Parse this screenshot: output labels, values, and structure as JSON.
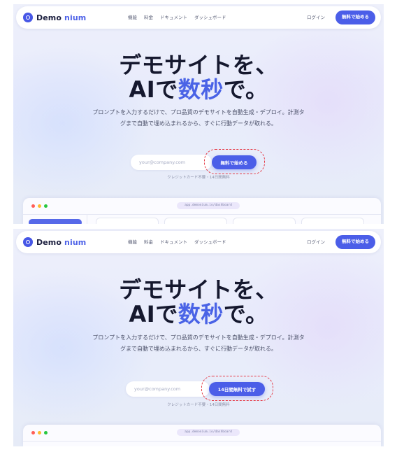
{
  "frames": [
    {
      "nav": {
        "brand_left": "Demo",
        "brand_right": "nium",
        "menu": [
          "機能",
          "料金",
          "ドキュメント",
          "ダッシュボード"
        ],
        "login": "ログイン",
        "cta": "無料で始める"
      },
      "hero": {
        "title_line1": "デモサイトを、",
        "title_ai": "AIで",
        "title_accent": "数秒",
        "title_end": "で。",
        "subtitle": "プロンプトを入力するだけで、プロ品質のデモサイトを自動生成・デプロイ。計測タグまで自動で埋め込まれるから、すぐに行動データが取れる。"
      },
      "form": {
        "email_placeholder": "your@company.com",
        "cta": "無料で始める",
        "note": "クレジットカード不要・14日間無料"
      },
      "browser": {
        "url": "app.demonium.io/dashboard"
      }
    },
    {
      "nav": {
        "brand_left": "Demo",
        "brand_right": "nium",
        "menu": [
          "機能",
          "料金",
          "ドキュメント",
          "ダッシュボード"
        ],
        "login": "ログイン",
        "cta": "無料で始める"
      },
      "hero": {
        "title_line1": "デモサイトを、",
        "title_ai": "AIで",
        "title_accent": "数秒",
        "title_end": "で。",
        "subtitle": "プロンプトを入力するだけで、プロ品質のデモサイトを自動生成・デプロイ。計測タグまで自動で埋め込まれるから、すぐに行動データが取れる。"
      },
      "form": {
        "email_placeholder": "your@company.com",
        "cta": "14日間無料で試す",
        "note": "クレジットカード不要・14日間無料"
      },
      "browser": {
        "url": "app.demonium.io/dashboard"
      }
    }
  ],
  "colors": {
    "accent": "#4b5ee8",
    "highlight": "#e53945",
    "title": "#15182e"
  },
  "icons": [
    "logo-mark-icon"
  ]
}
